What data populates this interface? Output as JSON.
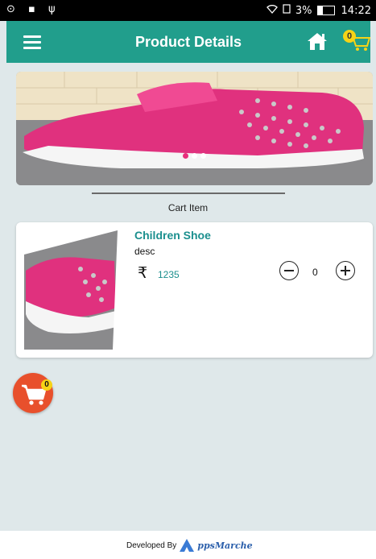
{
  "status_bar": {
    "left_icons": "⊙ ▪ ψ",
    "battery_text": "3%",
    "time": "14:22"
  },
  "app_bar": {
    "title": "Product Details",
    "cart_count": "0"
  },
  "section": {
    "label": "Cart Item"
  },
  "cart_item": {
    "name": "Children Shoe",
    "description": "desc",
    "currency": "₹",
    "price": "1235",
    "quantity": "0"
  },
  "fab": {
    "count": "0"
  },
  "footer": {
    "developed_by": "Developed By",
    "brand": "ppsMarche"
  },
  "colors": {
    "primary": "#219e8c",
    "accent": "#e8502c",
    "badge": "#f6d316",
    "product_text": "#1b8f8e"
  }
}
